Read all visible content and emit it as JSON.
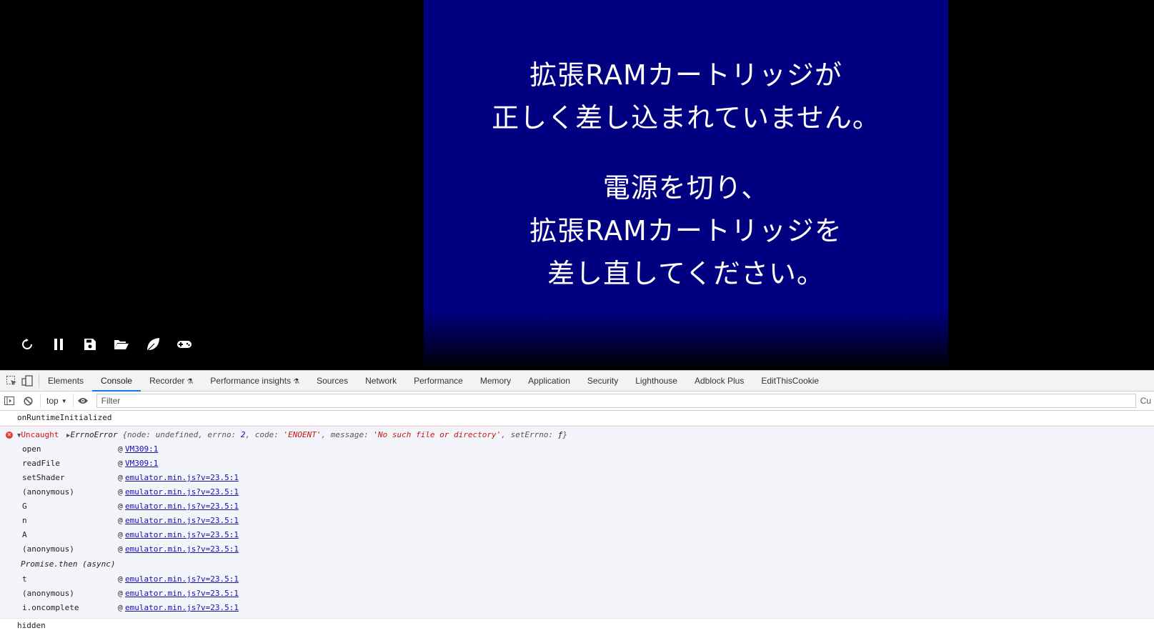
{
  "emulator": {
    "message_line1": "拡張RAMカートリッジが",
    "message_line2": "正しく差し込まれていません。",
    "message_line3": "電源を切り、",
    "message_line4": "拡張RAMカートリッジを",
    "message_line5": "差し直してください。",
    "controls": [
      "restart-icon",
      "pause-icon",
      "save-icon",
      "open-folder-icon",
      "leaf-icon",
      "gamepad-icon"
    ]
  },
  "devtools": {
    "tabs": [
      "Elements",
      "Console",
      "Recorder",
      "Performance insights",
      "Sources",
      "Network",
      "Performance",
      "Memory",
      "Application",
      "Security",
      "Lighthouse",
      "Adblock Plus",
      "EditThisCookie"
    ],
    "active_tab": "Console",
    "context": "top",
    "filter_placeholder": "Filter",
    "right_cut_text": "Cu"
  },
  "console": {
    "log1": "onRuntimeInitialized",
    "error": {
      "label": "Uncaught",
      "type": "ErrnoError",
      "node_key": "node:",
      "node_val": "undefined",
      "errno_key": "errno:",
      "errno_val": "2",
      "code_key": "code:",
      "code_val": "'ENOENT'",
      "message_key": "message:",
      "message_val": "'No such file or directory'",
      "seterrno_key": "setErrno:",
      "seterrno_val": "ƒ",
      "frames": [
        {
          "fn": "open",
          "src": "VM309:1"
        },
        {
          "fn": "readFile",
          "src": "VM309:1"
        },
        {
          "fn": "setShader",
          "src": "emulator.min.js?v=23.5:1"
        },
        {
          "fn": "(anonymous)",
          "src": "emulator.min.js?v=23.5:1"
        },
        {
          "fn": "G",
          "src": "emulator.min.js?v=23.5:1"
        },
        {
          "fn": "n",
          "src": "emulator.min.js?v=23.5:1"
        },
        {
          "fn": "A",
          "src": "emulator.min.js?v=23.5:1"
        },
        {
          "fn": "(anonymous)",
          "src": "emulator.min.js?v=23.5:1"
        }
      ],
      "async_label": "Promise.then (async)",
      "frames2": [
        {
          "fn": "t",
          "src": "emulator.min.js?v=23.5:1"
        },
        {
          "fn": "(anonymous)",
          "src": "emulator.min.js?v=23.5:1"
        },
        {
          "fn": "i.oncomplete",
          "src": "emulator.min.js?v=23.5:1"
        }
      ]
    },
    "log2": "hidden"
  }
}
